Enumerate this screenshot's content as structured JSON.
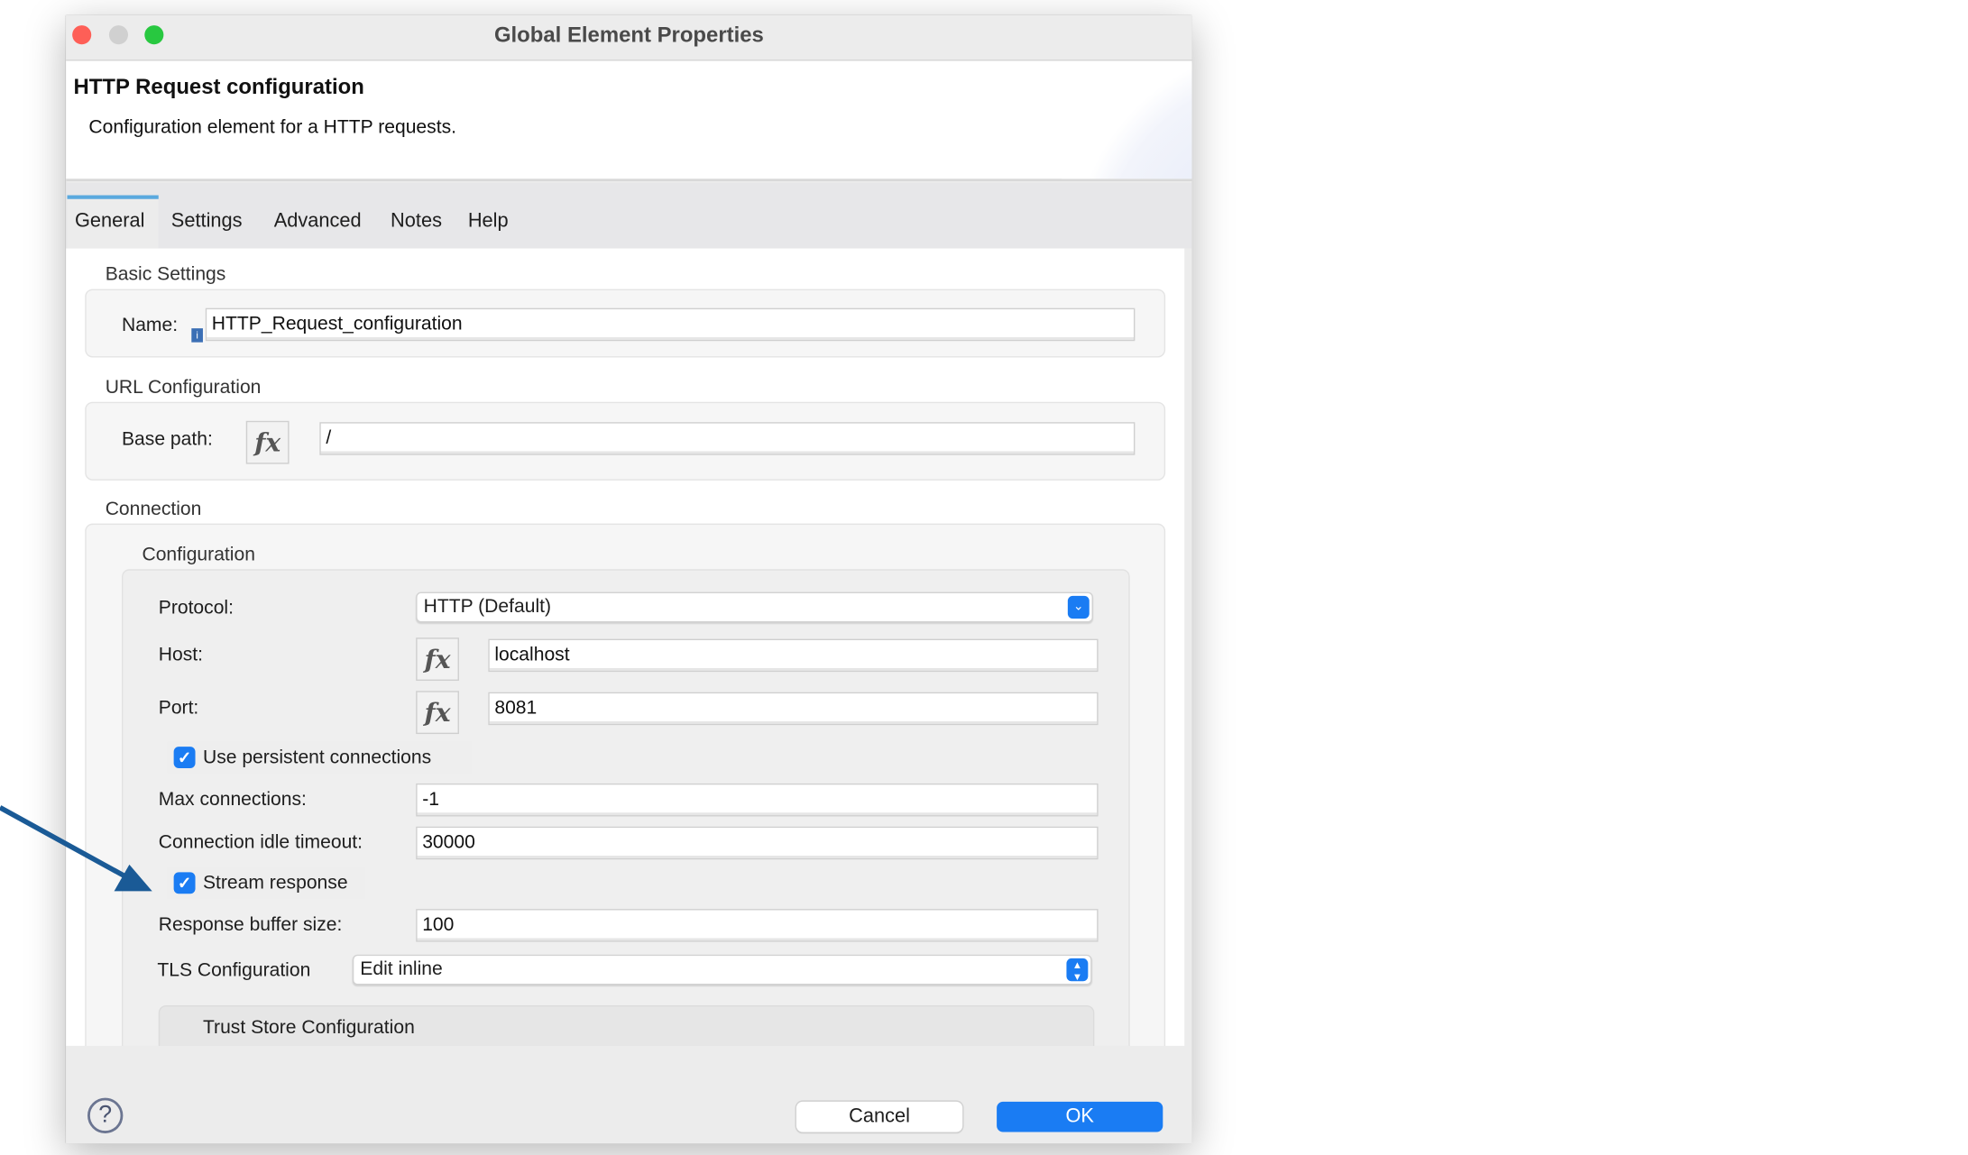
{
  "window": {
    "title": "Global Element Properties"
  },
  "header": {
    "title": "HTTP Request configuration",
    "description": "Configuration element for a HTTP requests."
  },
  "tabs": [
    {
      "label": "General",
      "active": true
    },
    {
      "label": "Settings"
    },
    {
      "label": "Advanced"
    },
    {
      "label": "Notes"
    },
    {
      "label": "Help"
    }
  ],
  "basic": {
    "section": "Basic Settings",
    "name_label": "Name:",
    "name_value": "HTTP_Request_configuration"
  },
  "url": {
    "section": "URL Configuration",
    "base_path_label": "Base path:",
    "base_path_value": "/",
    "fx": "fx"
  },
  "connection": {
    "section": "Connection",
    "subsection": "Configuration",
    "protocol_label": "Protocol:",
    "protocol_value": "HTTP (Default)",
    "host_label": "Host:",
    "host_value": "localhost",
    "port_label": "Port:",
    "port_value": "8081",
    "persistent_label": "Use persistent connections",
    "persistent_checked": true,
    "max_label": "Max connections:",
    "max_value": "-1",
    "idle_label": "Connection idle timeout:",
    "idle_value": "30000",
    "stream_label": "Stream response",
    "stream_checked": true,
    "buffer_label": "Response buffer size:",
    "buffer_value": "100",
    "tls_label": "TLS Configuration",
    "tls_value": "Edit inline",
    "trust_label": "Trust Store Configuration"
  },
  "footer": {
    "cancel": "Cancel",
    "ok": "OK"
  },
  "colors": {
    "accent": "#1a7cf3",
    "annotation_arrow": "#1a5a96",
    "tab_indicator": "#5aa9de"
  }
}
